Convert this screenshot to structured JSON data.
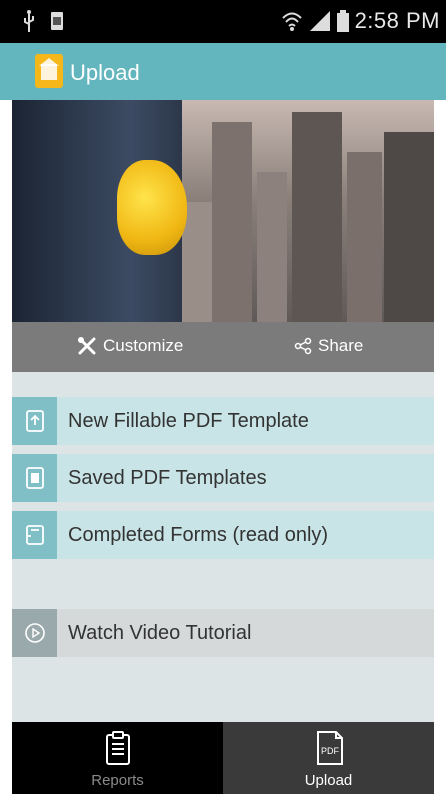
{
  "status_bar": {
    "time": "2:58 PM",
    "icons": [
      "usb-icon",
      "sim-icon",
      "wifi-icon",
      "signal-icon",
      "battery-icon"
    ]
  },
  "app_bar": {
    "title": "Upload",
    "logo_color": "#f6b71b",
    "bg_color": "#63b5be"
  },
  "hero": {
    "image": "construction-worker-with-yellow-helmet-city-skyline"
  },
  "actions": {
    "customize": {
      "label": "Customize",
      "icon": "tools-icon"
    },
    "share": {
      "label": "Share",
      "icon": "share-icon"
    }
  },
  "menu": {
    "items": [
      {
        "label": "New Fillable PDF Template",
        "icon": "upload-doc-icon"
      },
      {
        "label": "Saved PDF Templates",
        "icon": "saved-doc-icon"
      },
      {
        "label": "Completed Forms (read only)",
        "icon": "form-icon"
      },
      {
        "label": "Watch Video Tutorial",
        "icon": "play-icon"
      }
    ]
  },
  "bottom_nav": {
    "tabs": [
      {
        "label": "Reports",
        "icon": "clipboard-icon",
        "active": false
      },
      {
        "label": "Upload",
        "icon": "pdf-icon",
        "active": true,
        "icon_text": "PDF"
      }
    ]
  }
}
